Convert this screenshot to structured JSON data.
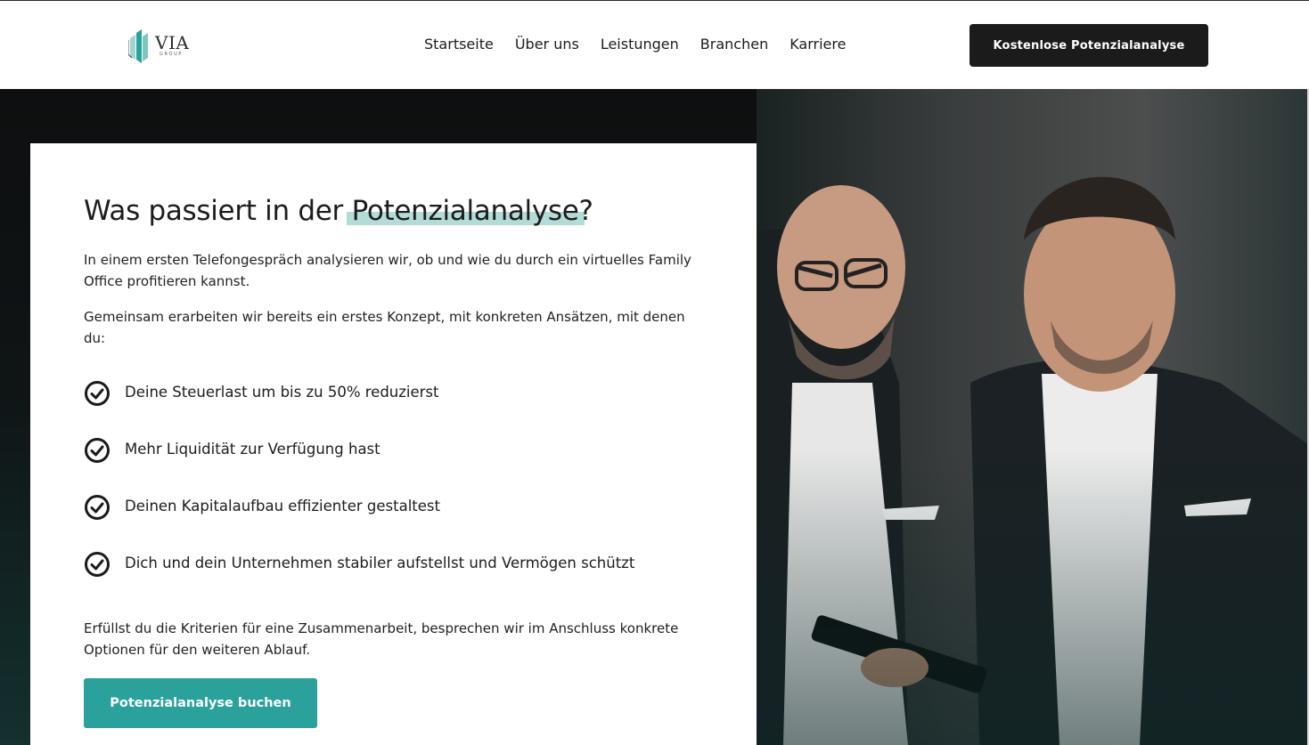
{
  "brand": {
    "name": "VIA",
    "sub": "GROUP",
    "accent": "#2aa19a",
    "highlight": "#b3dcd8"
  },
  "nav": {
    "items": [
      {
        "label": "Startseite"
      },
      {
        "label": "Über uns"
      },
      {
        "label": "Leistungen"
      },
      {
        "label": "Branchen"
      },
      {
        "label": "Karriere"
      }
    ],
    "cta_label": "Kostenlose Potenzialanalyse"
  },
  "hero": {
    "title_prefix": "Was passiert in der ",
    "title_highlight": "Potenzialanalyse",
    "title_suffix": "?",
    "intro": "In einem ersten Telefongespräch analysieren wir, ob und wie du durch ein virtuelles Family Office profitieren kannst.",
    "concept": "Gemeinsam erarbeiten wir bereits ein erstes Konzept, mit konkreten Ansätzen, mit denen du:",
    "benefits": [
      {
        "text": "Deine Steuerlast um bis zu 50% reduzierst",
        "icon": "check-circle-icon"
      },
      {
        "text": "Mehr Liquidität zur Verfügung hast",
        "icon": "check-circle-icon"
      },
      {
        "text": "Deinen Kapitalaufbau effizienter gestaltest",
        "icon": "check-circle-icon"
      },
      {
        "text": "Dich und dein Unternehmen stabiler aufstellst und Vermögen schützt",
        "icon": "check-circle-icon"
      }
    ],
    "closing": "Erfüllst du die Kriterien für eine Zusammenarbeit, besprechen wir im Anschluss konkrete Optionen für den weiteren Ablauf.",
    "button_label": "Potenzialanalyse buchen"
  }
}
